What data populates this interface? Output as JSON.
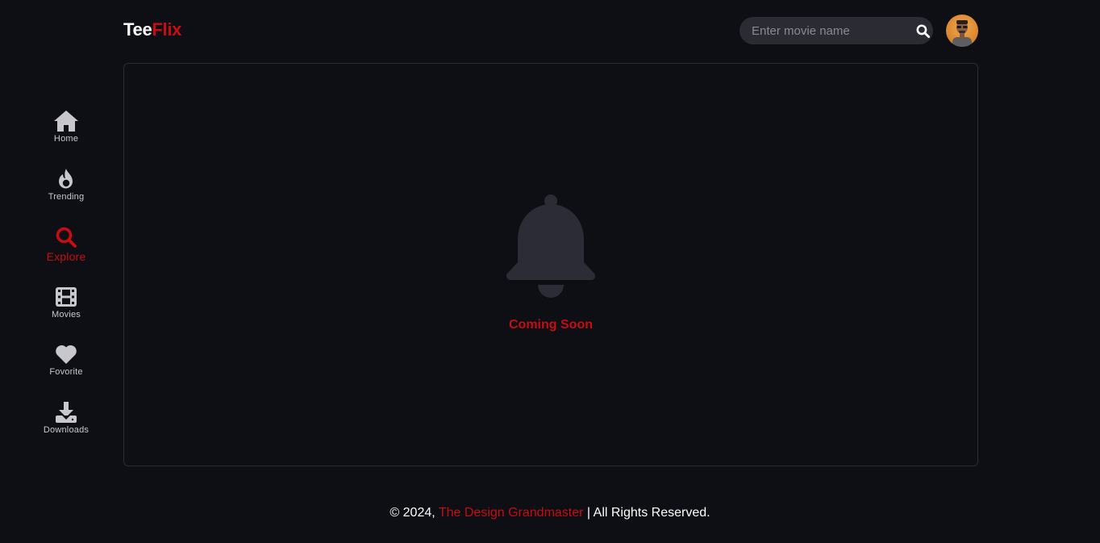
{
  "header": {
    "logo_part1": "Tee",
    "logo_part2": "Flix",
    "search_placeholder": "Enter movie name",
    "search_icon": "search-icon",
    "avatar": "user-avatar"
  },
  "sidebar": {
    "items": [
      {
        "label": "Home",
        "icon": "home-icon",
        "active": false
      },
      {
        "label": "Trending",
        "icon": "fire-icon",
        "active": false
      },
      {
        "label": "Explore",
        "icon": "search-icon",
        "active": true
      },
      {
        "label": "Movies",
        "icon": "film-icon",
        "active": false
      },
      {
        "label": "Fovorite",
        "icon": "heart-icon",
        "active": false
      },
      {
        "label": "Downloads",
        "icon": "download-icon",
        "active": false
      }
    ]
  },
  "main": {
    "icon": "bell-icon",
    "message": "Coming Soon"
  },
  "footer": {
    "prefix": "© 2024, ",
    "brand": "The Design Grandmaster",
    "suffix": " | All Rights Reserved."
  },
  "colors": {
    "background": "#0e0f14",
    "accent": "#c50d12",
    "icon_gray": "#c8c8cc",
    "bell": "#2b2c35"
  }
}
